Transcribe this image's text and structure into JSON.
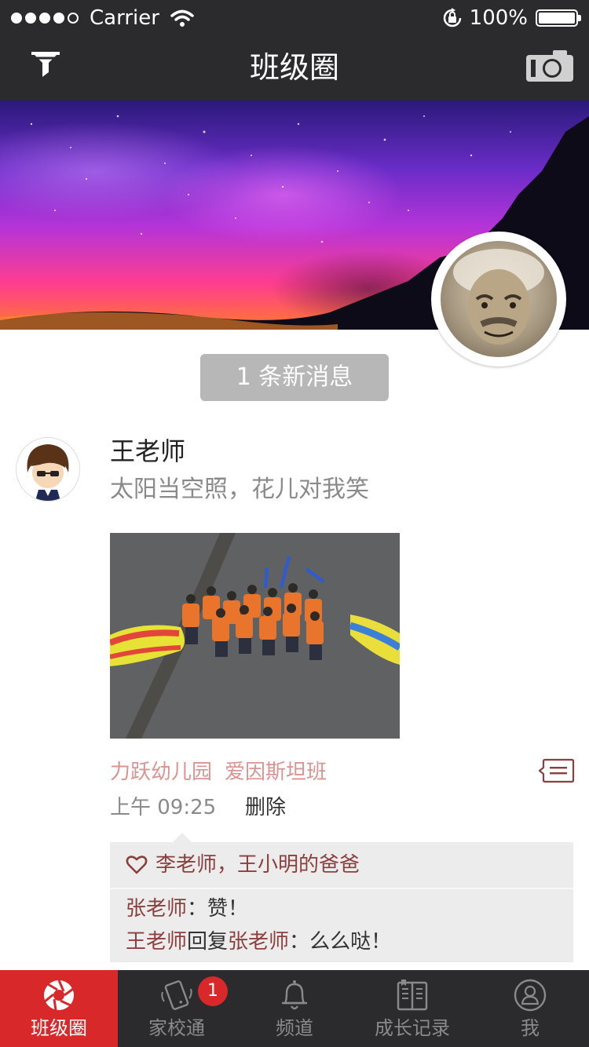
{
  "status_bar": {
    "carrier": "Carrier",
    "battery": "100%"
  },
  "nav": {
    "title": "班级圈"
  },
  "new_messages": {
    "label": "1 条新消息"
  },
  "post": {
    "author": "王老师",
    "text": "太阳当空照，花儿对我笑",
    "tags": [
      "力跃幼儿园",
      "爱因斯坦班"
    ],
    "time": "上午 09:25",
    "delete_label": "删除",
    "likes": "李老师，王小明的爸爸",
    "comments": [
      {
        "author": "张老师",
        "sep": "：",
        "text": "赞！"
      },
      {
        "author": "王老师",
        "reply_word": "回复",
        "reply_to": "张老师",
        "sep": "：",
        "text": "么么哒！"
      }
    ]
  },
  "tabs": [
    {
      "label": "班级圈",
      "icon": "shutter-icon",
      "active": true
    },
    {
      "label": "家校通",
      "icon": "phone-icon",
      "badge": "1"
    },
    {
      "label": "频道",
      "icon": "bell-icon"
    },
    {
      "label": "成长记录",
      "icon": "book-icon"
    },
    {
      "label": "我",
      "icon": "user-icon"
    }
  ],
  "colors": {
    "bar_background": "#2b2b2d",
    "accent_red": "#d9282a",
    "name_red": "#8b3f3e",
    "tag_pink": "#d99492"
  }
}
